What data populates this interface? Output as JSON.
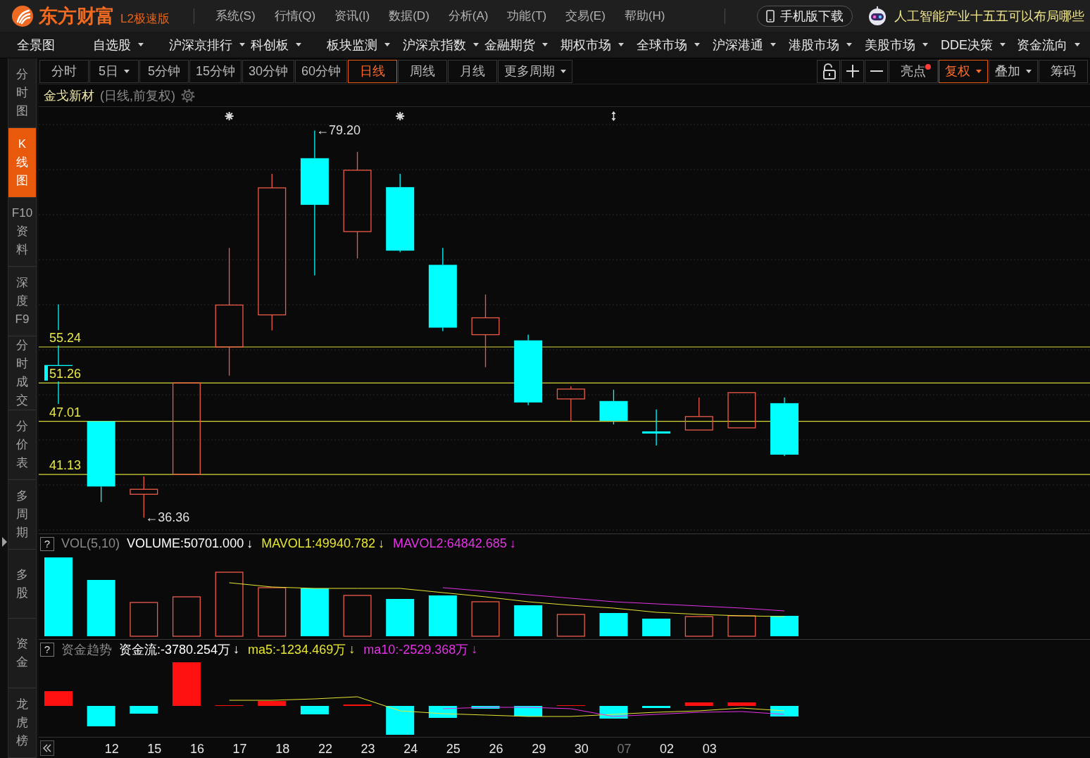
{
  "app_bar": {
    "brand": "东方财富",
    "edition": "L2极速版",
    "menus": [
      "系统(S)",
      "行情(Q)",
      "资讯(I)",
      "数据(D)",
      "分析(A)",
      "功能(T)",
      "交易(E)",
      "帮助(H)"
    ],
    "mobile_button": "手机版下载",
    "news_ticker": "人工智能产业十五五可以布局哪些"
  },
  "nav": [
    {
      "label": "全景图",
      "dropdown": false
    },
    {
      "label": "自选股",
      "dropdown": true
    },
    {
      "label": "沪深京排行",
      "dropdown": true
    },
    {
      "label": "科创板",
      "dropdown": true
    },
    {
      "label": "板块监测",
      "dropdown": true
    },
    {
      "label": "沪深京指数",
      "dropdown": true
    },
    {
      "label": "金融期货",
      "dropdown": true
    },
    {
      "label": "期权市场",
      "dropdown": true
    },
    {
      "label": "全球市场",
      "dropdown": true
    },
    {
      "label": "沪深港通",
      "dropdown": true
    },
    {
      "label": "港股市场",
      "dropdown": true
    },
    {
      "label": "美股市场",
      "dropdown": true
    },
    {
      "label": "DDE决策",
      "dropdown": true
    },
    {
      "label": "资金流向",
      "dropdown": true
    }
  ],
  "side_tabs": [
    {
      "label": "分时图",
      "selected": false
    },
    {
      "label": "K线图",
      "selected": true
    },
    {
      "label": "F10资料",
      "selected": false
    },
    {
      "label": "深度F9",
      "selected": false
    },
    {
      "label": "分时成交",
      "selected": false
    },
    {
      "label": "分价表",
      "selected": false
    },
    {
      "label": "多周期",
      "selected": false
    },
    {
      "label": "多股",
      "selected": false
    },
    {
      "label": "资金",
      "selected": false
    },
    {
      "label": "龙虎榜",
      "selected": false
    }
  ],
  "period_tabs": [
    {
      "label": "分时",
      "dropdown": false,
      "selected": false
    },
    {
      "label": "5日",
      "dropdown": true,
      "selected": false
    },
    {
      "label": "5分钟",
      "dropdown": false,
      "selected": false
    },
    {
      "label": "15分钟",
      "dropdown": false,
      "selected": false
    },
    {
      "label": "30分钟",
      "dropdown": false,
      "selected": false
    },
    {
      "label": "60分钟",
      "dropdown": false,
      "selected": false
    },
    {
      "label": "日线",
      "dropdown": false,
      "selected": true
    },
    {
      "label": "周线",
      "dropdown": false,
      "selected": false
    },
    {
      "label": "月线",
      "dropdown": false,
      "selected": false
    },
    {
      "label": "更多周期",
      "dropdown": true,
      "selected": false
    }
  ],
  "chart_tools": [
    {
      "label": "亮点",
      "has_alert": true,
      "dropdown": false,
      "selected": false
    },
    {
      "label": "复权",
      "has_alert": false,
      "dropdown": true,
      "selected": true
    },
    {
      "label": "叠加",
      "has_alert": false,
      "dropdown": true,
      "selected": false
    },
    {
      "label": "筹码",
      "has_alert": false,
      "dropdown": false,
      "selected": false
    }
  ],
  "chart": {
    "stock_name": "金戈新材",
    "period_note": "(日线,前复权)",
    "chart_data": [
      {
        "type": "candlestick",
        "categories": [
          null,
          "12",
          "15",
          "16",
          "17",
          "18",
          "22",
          "23",
          "24",
          "25",
          "26",
          "29",
          "30",
          "07",
          "02",
          "03",
          null,
          null
        ],
        "ohlc": [
          [
            53.24,
            59.96,
            48.94,
            51.52
          ],
          [
            47.01,
            47.01,
            38.08,
            39.8
          ],
          [
            38.94,
            40.9,
            36.36,
            39.49
          ],
          [
            41.13,
            51.26,
            41.13,
            51.26
          ],
          [
            55.24,
            66.21,
            52.07,
            59.88
          ],
          [
            58.79,
            74.41,
            57.07,
            72.85
          ],
          [
            76.13,
            79.2,
            63.16,
            70.97
          ],
          [
            68.01,
            76.83,
            65.04,
            74.8
          ],
          [
            72.93,
            74.41,
            65.74,
            65.9
          ],
          [
            64.33,
            66.21,
            56.99,
            57.38
          ],
          [
            56.6,
            61.05,
            53.01,
            58.47
          ],
          [
            55.97,
            56.6,
            48.79,
            49.1
          ],
          [
            49.49,
            50.89,
            46.99,
            50.58
          ],
          [
            49.26,
            50.5,
            46.68,
            47.07
          ],
          [
            45.9,
            48.32,
            44.33,
            45.66
          ],
          [
            46.05,
            49.65,
            46.05,
            47.54
          ],
          [
            46.29,
            50.19,
            46.29,
            50.19
          ],
          [
            49.02,
            49.65,
            43.16,
            43.32
          ]
        ],
        "ref_lines": [
          {
            "axis": "y",
            "value": 55.24,
            "label": "55.24"
          },
          {
            "axis": "y",
            "value": 51.26,
            "label": "51.26"
          },
          {
            "axis": "y",
            "value": 47.01,
            "label": "47.01"
          },
          {
            "axis": "y",
            "value": 41.13,
            "label": "41.13"
          }
        ],
        "annotations": [
          "←79.20",
          "←36.36"
        ]
      }
    ]
  },
  "volume": {
    "help_label": "?",
    "indicator": "VOL(5,10)",
    "readings": [
      {
        "text": "VOLUME:50701.000",
        "arrow": "↓",
        "color": "#ffffff"
      },
      {
        "text": "MAVOL1:49940.782",
        "arrow": "↓",
        "color": "#e6e632"
      },
      {
        "text": "MAVOL2:64842.685",
        "arrow": "↓",
        "color": "#e632e6"
      }
    ]
  },
  "fund_flow": {
    "help_label": "?",
    "indicator": "资金趋势",
    "readings": [
      {
        "text": "资金流:-3780.254万",
        "arrow": "↓",
        "color": "#ffffff"
      },
      {
        "text": "ma5:-1234.469万",
        "arrow": "↓",
        "color": "#e6e632"
      },
      {
        "text": "ma10:-2529.368万",
        "arrow": "↓",
        "color": "#e632e6"
      }
    ]
  },
  "time_axis": {
    "dimmed": [
      false,
      false,
      false,
      false,
      false,
      false,
      false,
      false,
      false,
      false,
      false,
      false,
      true,
      false,
      false
    ]
  }
}
